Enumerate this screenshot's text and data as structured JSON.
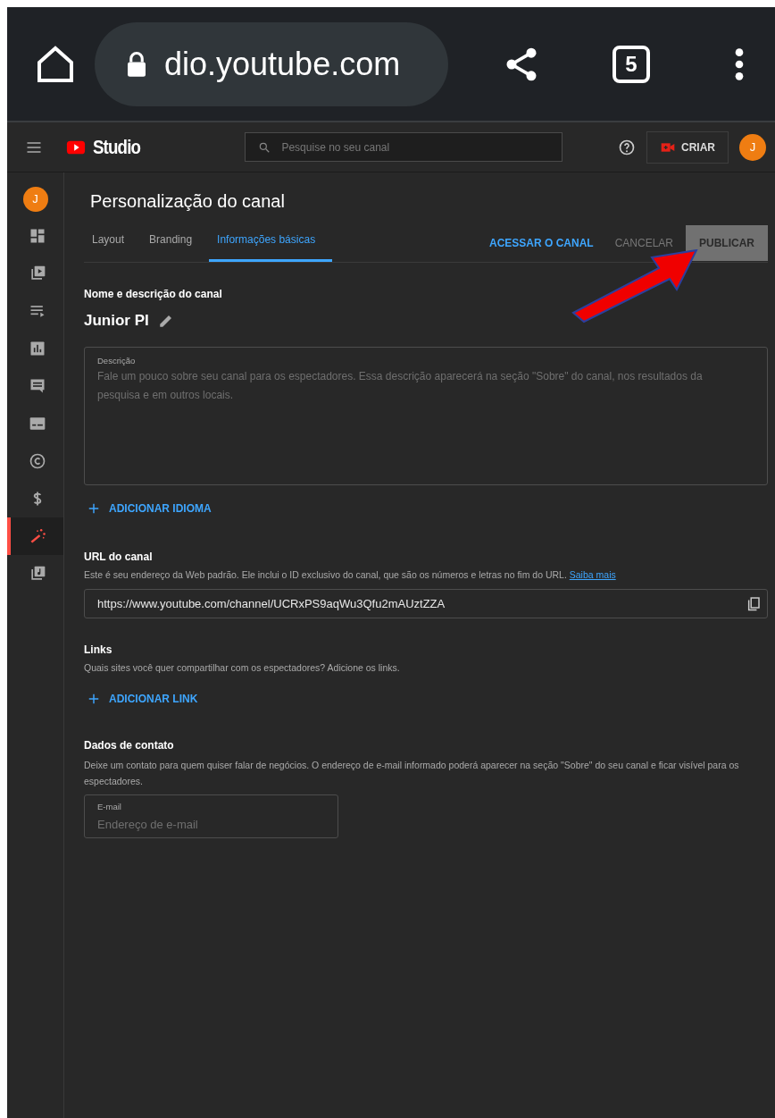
{
  "browser": {
    "url": "dio.youtube.com",
    "tab_count": "5"
  },
  "header": {
    "logo": "Studio",
    "search": {
      "placeholder": "Pesquise no seu canal"
    },
    "create_button": "CRIAR",
    "avatar": "J"
  },
  "sidebar": {
    "avatar": "J",
    "items": [
      {
        "kind": "dashboard",
        "selected": false
      },
      {
        "kind": "content",
        "selected": false
      },
      {
        "kind": "playlists",
        "selected": false
      },
      {
        "kind": "analytics",
        "selected": false
      },
      {
        "kind": "comments",
        "selected": false
      },
      {
        "kind": "subtitles",
        "selected": false
      },
      {
        "kind": "copyright",
        "selected": false
      },
      {
        "kind": "earn",
        "selected": false
      },
      {
        "kind": "customization",
        "selected": true
      },
      {
        "kind": "audio",
        "selected": false
      }
    ]
  },
  "page": {
    "title": "Personalização do canal",
    "tabs": [
      {
        "label": "Layout",
        "selected": false
      },
      {
        "label": "Branding",
        "selected": false
      },
      {
        "label": "Informações básicas",
        "selected": true
      }
    ],
    "actions": [
      {
        "label": "ACESSAR O CANAL",
        "kind": "link"
      },
      {
        "label": "CANCELAR",
        "kind": "text"
      },
      {
        "label": "PUBLICAR",
        "kind": "filled"
      }
    ]
  },
  "name_section": {
    "heading": "Nome e descrição do canal",
    "channel_name": "Junior PI",
    "description": {
      "label": "Descrição",
      "placeholder": "Fale um pouco sobre seu canal para os espectadores. Essa descrição aparecerá na seção \"Sobre\" do canal, nos resultados da pesquisa e em outros locais."
    },
    "add_button": "ADICIONAR IDIOMA"
  },
  "url_section": {
    "heading": "URL do canal",
    "help": "Este é seu endereço da Web padrão. Ele inclui o ID exclusivo do canal, que são os números e letras no fim do URL.",
    "help_link": "Saiba mais",
    "value": "https://www.youtube.com/channel/UCRxPS9aqWu3Qfu2mAUztZZA"
  },
  "links_section": {
    "heading": "Links",
    "help": "Quais sites você quer compartilhar com os espectadores? Adicione os links.",
    "add_button": "ADICIONAR LINK"
  },
  "contact_section": {
    "heading": "Dados de contato",
    "help": "Deixe um contato para quem quiser falar de negócios. O endereço de e-mail informado poderá aparecer na seção \"Sobre\" do seu canal e ficar visível para os espectadores.",
    "email": {
      "label": "E-mail",
      "placeholder": "Endereço de e-mail"
    }
  }
}
